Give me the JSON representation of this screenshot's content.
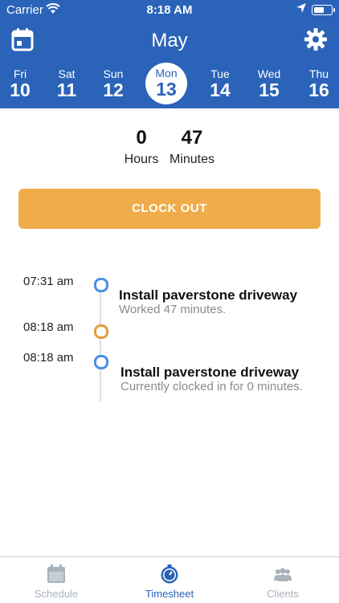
{
  "status_bar": {
    "carrier": "Carrier",
    "time": "8:18 AM",
    "battery_level": 0.6
  },
  "header": {
    "month": "May"
  },
  "days": [
    {
      "name": "Fri",
      "date": "10"
    },
    {
      "name": "Sat",
      "date": "11"
    },
    {
      "name": "Sun",
      "date": "12"
    },
    {
      "name": "Mon",
      "date": "13",
      "selected": true
    },
    {
      "name": "Tue",
      "date": "14"
    },
    {
      "name": "Wed",
      "date": "15"
    },
    {
      "name": "Thu",
      "date": "16"
    }
  ],
  "totals": {
    "hours_value": "0",
    "hours_label": "Hours",
    "minutes_value": "47",
    "minutes_label": "Minutes"
  },
  "clock_button": "CLOCK OUT",
  "timeline": [
    {
      "time": "07:31 am",
      "dot": "blue",
      "title": "Install paverstone driveway",
      "subtitle": "Worked 47 minutes."
    },
    {
      "time": "08:18 am",
      "dot": "orange"
    },
    {
      "time": "08:18 am",
      "dot": "blue",
      "title": "Install paverstone driveway",
      "subtitle": "Currently clocked in for 0 minutes."
    }
  ],
  "tabs": [
    {
      "label": "Schedule",
      "icon": "calendar-icon",
      "active": false
    },
    {
      "label": "Timesheet",
      "icon": "stopwatch-icon",
      "active": true
    },
    {
      "label": "Clients",
      "icon": "people-icon",
      "active": false
    }
  ],
  "colors": {
    "header": "#2a63b8",
    "clock_button": "#f0ac4a",
    "dot_blue": "#4a90e2",
    "dot_orange": "#e49c3b",
    "tab_active": "#2a63b8",
    "tab_inactive": "#a8b2bd"
  }
}
